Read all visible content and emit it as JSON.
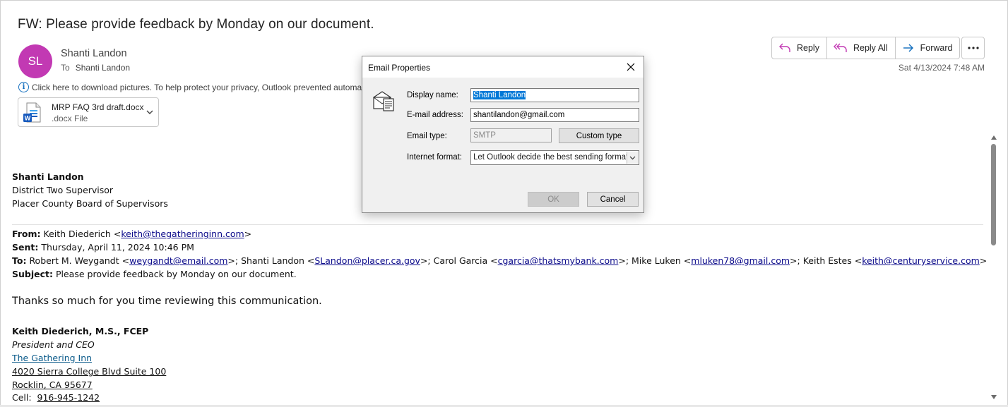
{
  "email": {
    "subject": "FW: Please provide feedback by Monday on our document.",
    "avatar_initials": "SL",
    "avatar_color": "#c239b3",
    "sender_name": "Shanti Landon",
    "to_label": "To",
    "to_value": "Shanti Landon",
    "privacy_notice": "Click here to download pictures. To help protect your privacy, Outlook prevented automatic download of some pictures in this message.",
    "attachment": {
      "name": "MRP FAQ 3rd draft.docx",
      "type": ".docx File"
    },
    "actions": {
      "reply": "Reply",
      "reply_all": "Reply All",
      "forward": "Forward"
    },
    "timestamp": "Sat 4/13/2024 7:48 AM"
  },
  "body": {
    "signature1": {
      "name": "Shanti Landon",
      "title": "District Two Supervisor",
      "org": "Placer County Board of Supervisors"
    },
    "forward_header": {
      "from_label": "From:",
      "from_name": "Keith Diederich <",
      "from_email": "keith@thegatheringinn.com",
      "from_end": ">",
      "sent_label": "Sent:",
      "sent_value": "Thursday, April 11, 2024 10:46 PM",
      "to_label": "To:",
      "to_r1_name": "Robert M. Weygandt <",
      "to_r1_email": "weygandt@email.com",
      "to_r2_name": ">; Shanti Landon <",
      "to_r2_email": "SLandon@placer.ca.gov",
      "to_r3_name": ">; Carol Garcia <",
      "to_r3_email": "cgarcia@thatsmybank.com",
      "to_r4_name": ">; Mike Luken <",
      "to_r4_email": "mluken78@gmail.com",
      "to_r5_name": ">; Keith Estes <",
      "to_r5_email": "keith@centuryservice.com",
      "to_end": ">",
      "subject_label": "Subject:",
      "subject_value": "Please provide feedback by Monday on our document."
    },
    "message": "Thanks so much for you time reviewing this communication.",
    "signature2": {
      "name": "Keith Diederich, M.S., FCEP",
      "title": "President and CEO",
      "org": "The Gathering Inn",
      "address1": "4020 Sierra College Blvd Suite 100",
      "address2": "Rocklin, CA 95677",
      "cell_label": "Cell:",
      "cell_value": "916-945-1242"
    }
  },
  "dialog": {
    "title": "Email Properties",
    "display_name_label": "Display name:",
    "display_name_value": "Shanti Landon",
    "email_label": "E-mail address:",
    "email_value": "shantilandon@gmail.com",
    "type_label": "Email type:",
    "type_value": "SMTP",
    "custom_type_button": "Custom type",
    "format_label": "Internet format:",
    "format_value": "Let Outlook decide the best sending format",
    "ok_button": "OK",
    "cancel_button": "Cancel"
  }
}
